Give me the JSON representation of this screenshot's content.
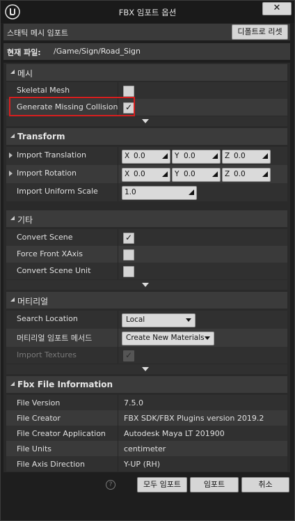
{
  "window": {
    "title": "FBX 임포트 옵션",
    "close_glyph": "✕"
  },
  "header": {
    "label": "스태틱 메시 임포트",
    "reset_button": "디폴트로 리셋"
  },
  "file": {
    "label": "현재 파일:",
    "path": "/Game/Sign/Road_Sign"
  },
  "mesh": {
    "title": "메시",
    "skeletal_mesh": {
      "label": "Skeletal Mesh",
      "checked": false
    },
    "generate_collision": {
      "label": "Generate Missing Collision",
      "checked": true
    }
  },
  "transform": {
    "title": "Transform",
    "translation": {
      "label": "Import Translation",
      "x": "0.0",
      "y": "0.0",
      "z": "0.0"
    },
    "rotation": {
      "label": "Import Rotation",
      "x": "0.0",
      "y": "0.0",
      "z": "0.0"
    },
    "scale": {
      "label": "Import Uniform Scale",
      "value": "1.0"
    },
    "axis_labels": {
      "x": "X",
      "y": "Y",
      "z": "Z"
    }
  },
  "misc": {
    "title": "기타",
    "convert_scene": {
      "label": "Convert Scene",
      "checked": true
    },
    "force_front_xaxis": {
      "label": "Force Front XAxis",
      "checked": false
    },
    "convert_scene_unit": {
      "label": "Convert Scene Unit",
      "checked": false
    }
  },
  "material": {
    "title": "머티리얼",
    "search_location": {
      "label": "Search Location",
      "value": "Local"
    },
    "import_method": {
      "label": "머티리얼 임포트 메서드",
      "value": "Create New Materials"
    },
    "import_textures": {
      "label": "Import Textures",
      "checked": true,
      "disabled": true
    }
  },
  "fbx_info": {
    "title": "Fbx File Information",
    "rows": [
      {
        "label": "File Version",
        "value": "7.5.0"
      },
      {
        "label": "File Creator",
        "value": "FBX SDK/FBX Plugins version 2019.2"
      },
      {
        "label": "File Creator Application",
        "value": "Autodesk Maya LT 201900"
      },
      {
        "label": "File Units",
        "value": "centimeter"
      },
      {
        "label": "File Axis Direction",
        "value": "Y-UP (RH)"
      }
    ]
  },
  "footer": {
    "help_glyph": "?",
    "import_all": "모두 임포트",
    "import": "임포트",
    "cancel": "취소"
  },
  "colors": {
    "highlight": "#d81e1e",
    "background": "#1e1e1e"
  }
}
